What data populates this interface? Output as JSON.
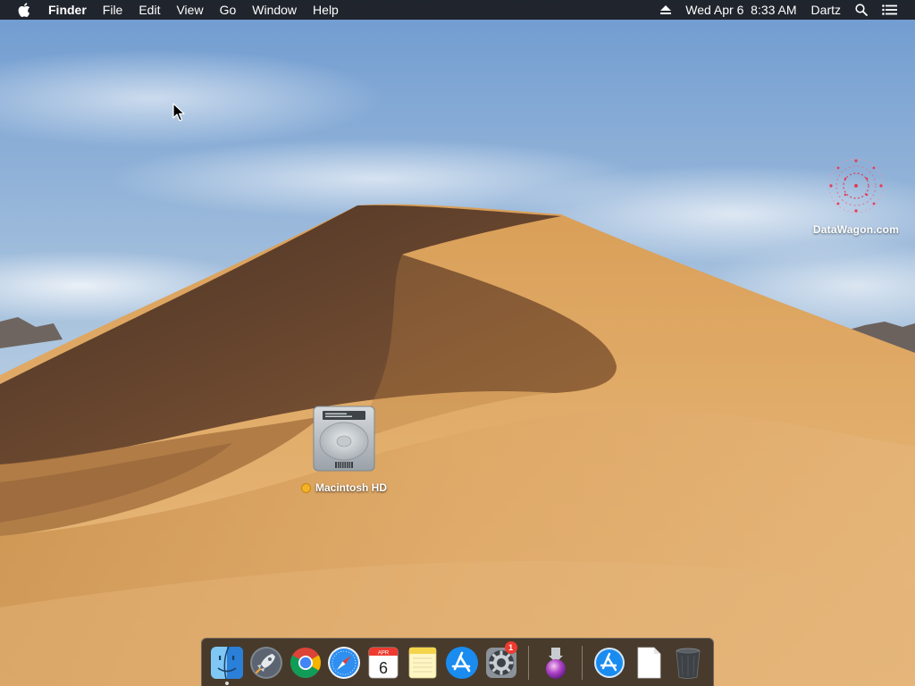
{
  "menubar": {
    "apple_icon": "apple-logo-icon",
    "app_name": "Finder",
    "menus": [
      "File",
      "Edit",
      "View",
      "Go",
      "Window",
      "Help"
    ],
    "eject_icon": "eject-icon",
    "datetime": "Wed Apr 6  8:33 AM",
    "user": "Dartz",
    "search_icon": "magnifier-icon",
    "notifications_icon": "list-icon"
  },
  "desktop": {
    "hd_label": "Macintosh HD",
    "hd_tag_color": "#f5b324",
    "watermark_label": "DataWagon.com"
  },
  "dock": {
    "items": [
      {
        "name": "Finder",
        "icon": "finder-icon",
        "running": true
      },
      {
        "name": "Launchpad",
        "icon": "rocket-icon"
      },
      {
        "name": "Google Chrome",
        "icon": "chrome-icon"
      },
      {
        "name": "Safari",
        "icon": "compass-icon"
      },
      {
        "name": "Calendar",
        "icon": "calendar-icon",
        "month": "APR",
        "day": "6"
      },
      {
        "name": "Notes",
        "icon": "notes-icon"
      },
      {
        "name": "App Store",
        "icon": "app-store-icon"
      },
      {
        "name": "System Preferences",
        "icon": "gear-icon",
        "badge": "1"
      },
      {
        "name": "Installer",
        "icon": "installer-icon"
      },
      {
        "name": "Downloads",
        "icon": "app-store-folder-icon"
      },
      {
        "name": "Document",
        "icon": "blank-document-icon"
      },
      {
        "name": "Trash",
        "icon": "trash-icon"
      }
    ]
  },
  "colors": {
    "menubar_bg": "#141416",
    "sand": "#d9a25a",
    "sky": "#a8c2db"
  }
}
